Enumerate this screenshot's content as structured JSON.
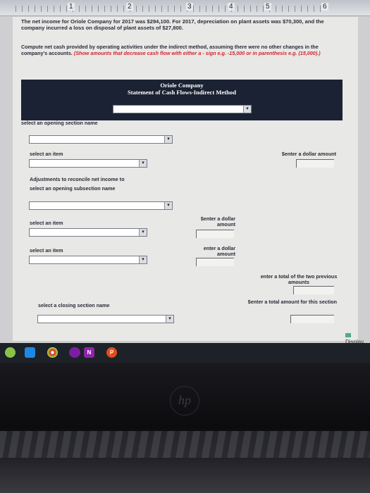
{
  "ruler": {
    "marks": [
      "1",
      "2",
      "3",
      "4",
      "5",
      "6"
    ]
  },
  "problem": {
    "intro": "The net income for Oriole Company for 2017 was $294,100. For 2017, depreciation on plant assets was $70,300, and the company incurred a loss on disposal of plant assets of $27,800.",
    "prompt": "Compute net cash provided by operating activities under the indirect method, assuming there were no other changes in the company's accounts.",
    "instruction": "(Show amounts that decrease cash flow with either a - sign e.g. -15,000 or in parenthesis e.g. (15,000).)"
  },
  "statement": {
    "company": "Oriole Company",
    "title": "Statement of Cash Flows-Indirect Method",
    "opening_section_label": "select an opening section name",
    "item_label": "select an item",
    "enter_dollar_label": "$enter a dollar amount",
    "adjustments_text": "Adjustments to reconcile net income to",
    "opening_subsection_label": "select an opening subsection name",
    "item2_label": "select an item",
    "enter_dollar2_label": "$enter a dollar amount",
    "item3_label": "select an item",
    "enter_dollar3_label": "enter a dollar amount",
    "total_two_label": "enter a total of the two previous amounts",
    "closing_section_label": "select a closing section name",
    "total_section_label": "$enter a total amount for this section"
  },
  "taskbar": {
    "display_label": "Display",
    "onenote_label": "N",
    "pp_label": "P"
  },
  "brand": {
    "logo": "hp"
  },
  "colors": {
    "banner": "#1b2233",
    "red_note": "#d4232b"
  }
}
